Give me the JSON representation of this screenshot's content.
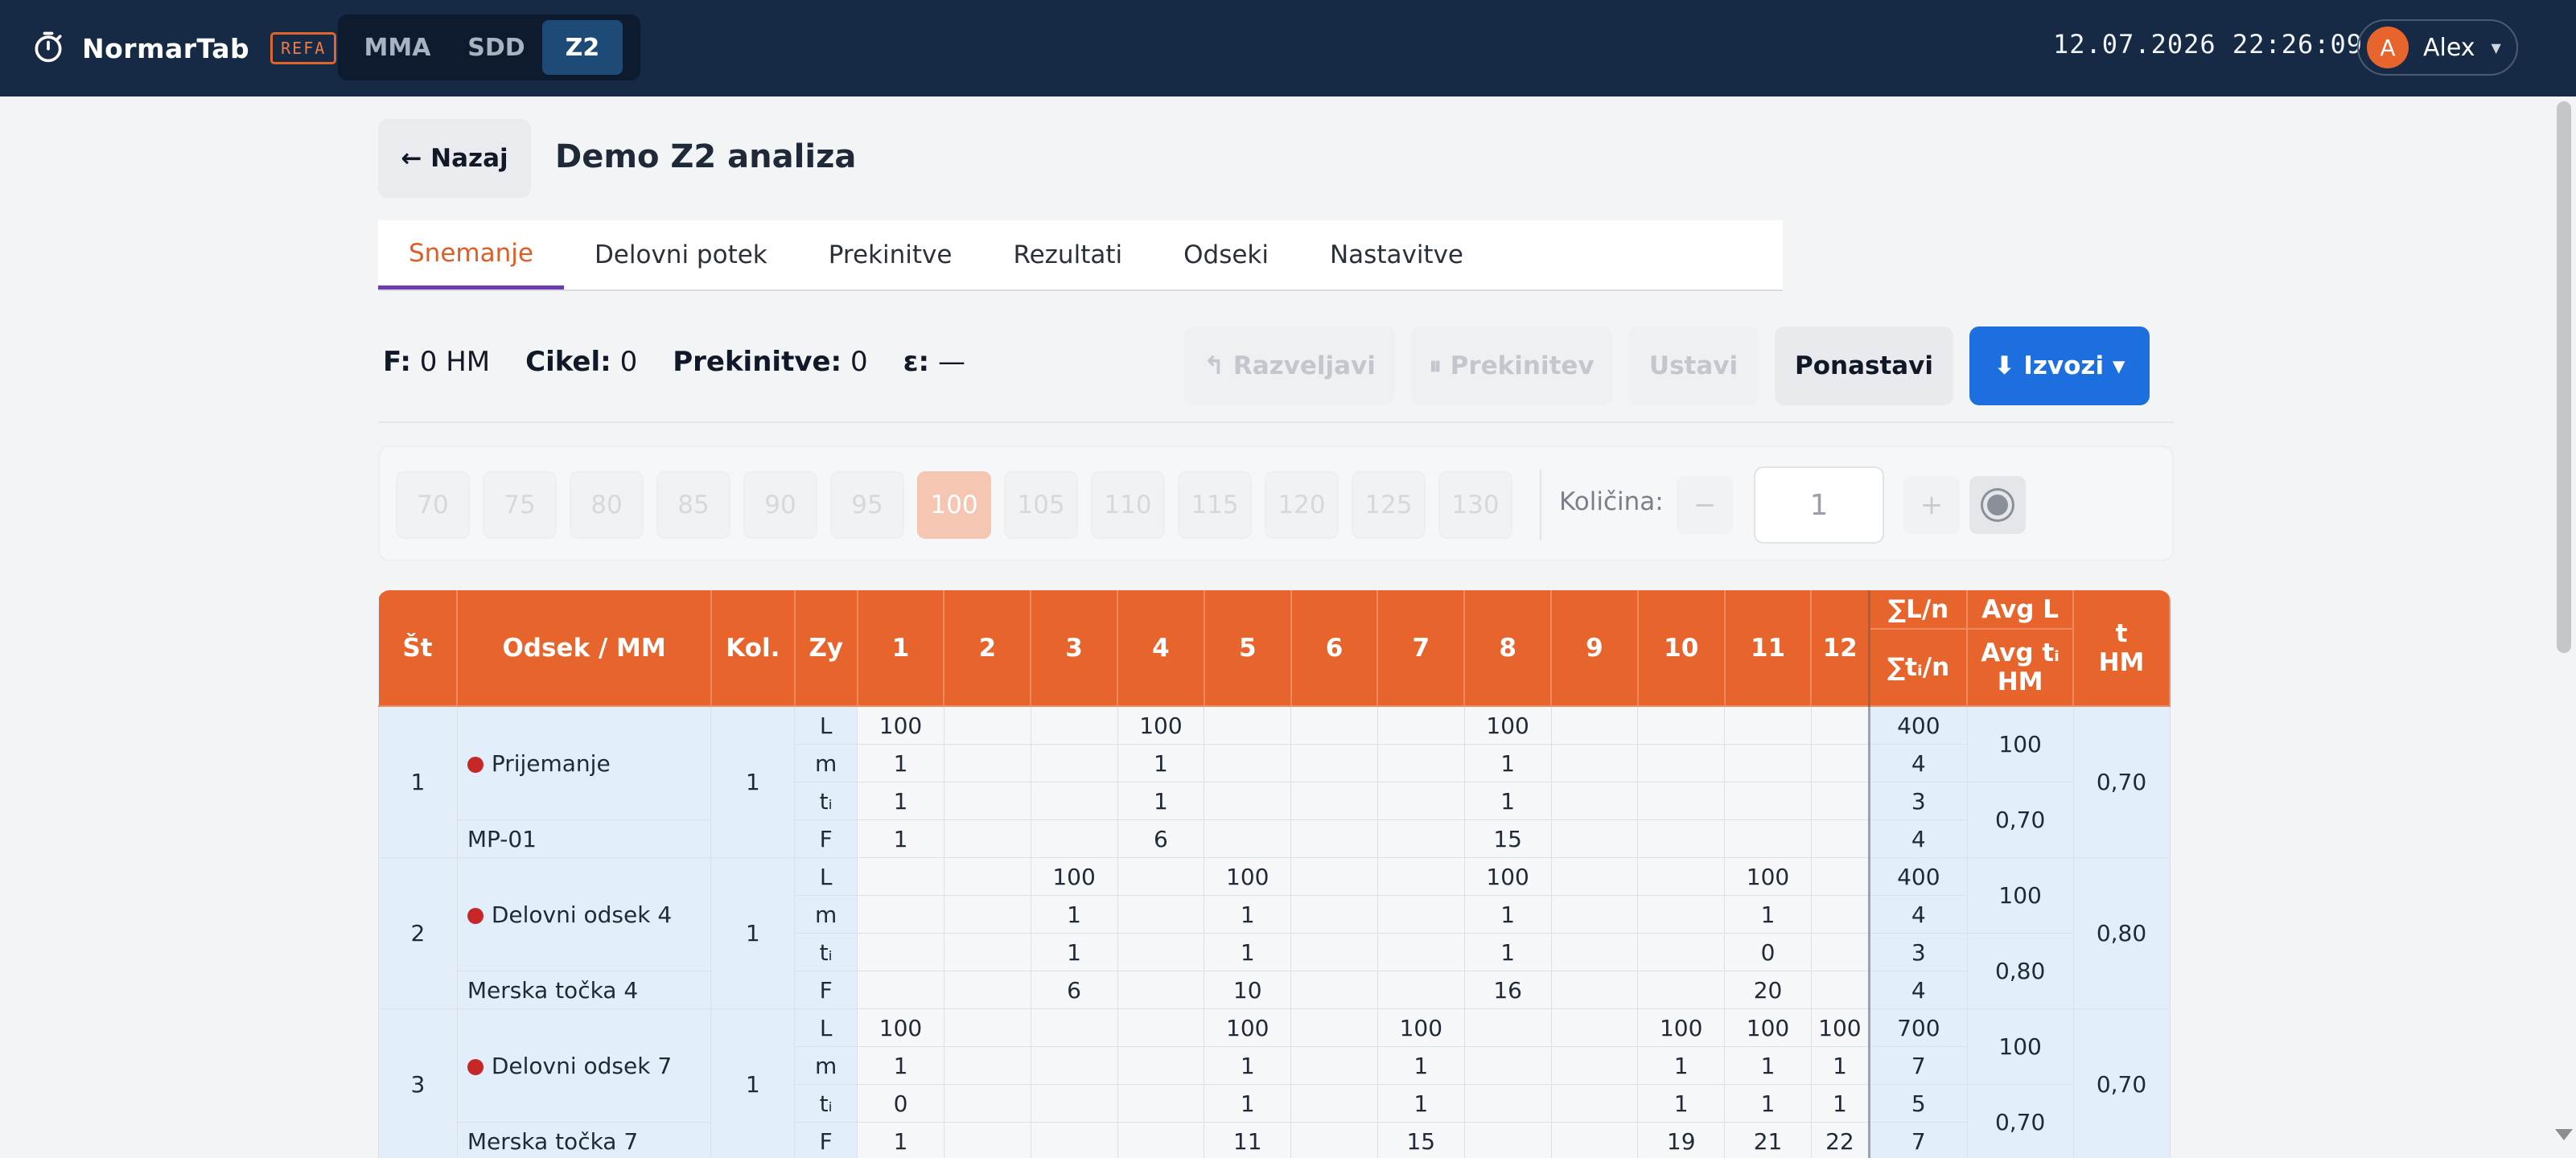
{
  "app": {
    "name": "NormarTab",
    "badge": "REFA",
    "modes": [
      "MMA",
      "SDD",
      "Z2"
    ],
    "active_mode": "Z2",
    "datetime": "12.07.2026 22:26:09",
    "user_initial": "A",
    "user_name": "Alex"
  },
  "header": {
    "back_label": "← Nazaj",
    "title": "Demo Z2 analiza"
  },
  "tabs": [
    "Snemanje",
    "Delovni potek",
    "Prekinitve",
    "Rezultati",
    "Odseki",
    "Nastavitve"
  ],
  "active_tab": "Snemanje",
  "stats": {
    "f_label": "F:",
    "f_value": "0 HM",
    "cycle_label": "Cikel:",
    "cycle_value": "0",
    "breaks_label": "Prekinitve:",
    "breaks_value": "0",
    "eps_label": "ε:",
    "eps_value": "—"
  },
  "actions": {
    "undo": "↰ Razveljavi",
    "pause": "⏸ Prekinitev",
    "stop": "Ustavi",
    "reset": "Ponastavi",
    "export": "⬇ Izvozi ▾"
  },
  "ratings": [
    "70",
    "75",
    "80",
    "85",
    "90",
    "95",
    "100",
    "105",
    "110",
    "115",
    "120",
    "125",
    "130"
  ],
  "selected_rating": "100",
  "quantity": {
    "label": "Količina:",
    "minus": "−",
    "plus": "+",
    "value": "1"
  },
  "table": {
    "headers": {
      "st": "Št",
      "odsek": "Odsek / MM",
      "kol": "Kol.",
      "zy": "Zy",
      "cycles": [
        "1",
        "2",
        "3",
        "4",
        "5",
        "6",
        "7",
        "8",
        "9",
        "10",
        "11",
        "12"
      ],
      "sum_l": "∑L/n",
      "sum_t": "∑tᵢ/n",
      "avg_l": "Avg L",
      "avg_t": "Avg tᵢ",
      "avg_unit": "HM",
      "t": "t",
      "t_unit": "HM"
    },
    "row_labels": [
      "L",
      "m",
      "tᵢ",
      "F"
    ],
    "sections": [
      {
        "st": "1",
        "name": "Prijemanje",
        "mp": "MP-01",
        "kol": "1",
        "cells": {
          "L": [
            "100",
            "",
            "",
            "100",
            "",
            "",
            "",
            "100",
            "",
            "",
            "",
            ""
          ],
          "m": [
            "1",
            "",
            "",
            "1",
            "",
            "",
            "",
            "1",
            "",
            "",
            "",
            ""
          ],
          "ti": [
            "1",
            "",
            "",
            "1",
            "",
            "",
            "",
            "1",
            "",
            "",
            "",
            ""
          ],
          "F": [
            "1",
            "",
            "",
            "6",
            "",
            "",
            "",
            "15",
            "",
            "",
            "",
            ""
          ]
        },
        "sums": [
          "400",
          "4",
          "3",
          "4"
        ],
        "avg_l": "100",
        "avg_t": "0,70",
        "t": "0,70"
      },
      {
        "st": "2",
        "name": "Delovni odsek 4",
        "mp": "Merska točka 4",
        "kol": "1",
        "cells": {
          "L": [
            "",
            "",
            "100",
            "",
            "100",
            "",
            "",
            "100",
            "",
            "",
            "100",
            ""
          ],
          "m": [
            "",
            "",
            "1",
            "",
            "1",
            "",
            "",
            "1",
            "",
            "",
            "1",
            ""
          ],
          "ti": [
            "",
            "",
            "1",
            "",
            "1",
            "",
            "",
            "1",
            "",
            "",
            "0",
            ""
          ],
          "F": [
            "",
            "",
            "6",
            "",
            "10",
            "",
            "",
            "16",
            "",
            "",
            "20",
            ""
          ]
        },
        "sums": [
          "400",
          "4",
          "3",
          "4"
        ],
        "avg_l": "100",
        "avg_t": "0,80",
        "t": "0,80"
      },
      {
        "st": "3",
        "name": "Delovni odsek 7",
        "mp": "Merska točka 7",
        "kol": "1",
        "cells": {
          "L": [
            "100",
            "",
            "",
            "",
            "100",
            "",
            "100",
            "",
            "",
            "100",
            "100",
            "100"
          ],
          "m": [
            "1",
            "",
            "",
            "",
            "1",
            "",
            "1",
            "",
            "",
            "1",
            "1",
            "1"
          ],
          "ti": [
            "0",
            "",
            "",
            "",
            "1",
            "",
            "1",
            "",
            "",
            "1",
            "1",
            "1"
          ],
          "F": [
            "1",
            "",
            "",
            "",
            "11",
            "",
            "15",
            "",
            "",
            "19",
            "21",
            "22"
          ]
        },
        "sums": [
          "700",
          "7",
          "5",
          "7"
        ],
        "avg_l": "100",
        "avg_t": "0,70",
        "t": "0,70"
      }
    ]
  },
  "colors": {
    "topbar": "#172a45",
    "accent": "#e8642d",
    "primary": "#1d6fe0",
    "tab_underline": "#6f3bb0",
    "status_dot": "#c62828"
  },
  "icons": [
    "stopwatch-icon",
    "chevron-down-icon",
    "undo-icon",
    "pause-icon",
    "download-icon",
    "target-icon"
  ]
}
